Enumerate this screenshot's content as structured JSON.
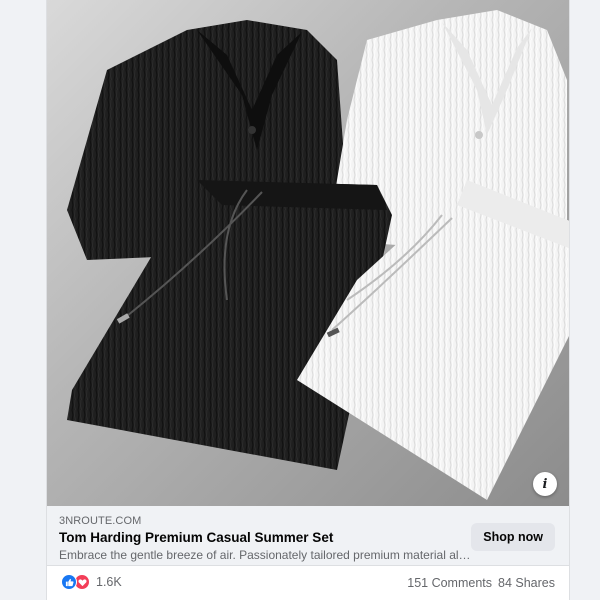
{
  "ad": {
    "image_alt": "",
    "domain": "3NROUTE.COM",
    "title": "Tom Harding Premium Casual Summer Set",
    "description": "Embrace the gentle breeze of air. Passionately tailored premium material allo...",
    "cta_label": "Shop now",
    "info_label": "i"
  },
  "engagement": {
    "reactions": [
      "like-icon",
      "love-icon"
    ],
    "reaction_count": "1.6K",
    "comments": "151 Comments",
    "shares": "84 Shares"
  },
  "colors": {
    "like": "#1877f2",
    "love": "#f33e58",
    "page_bg": "#f0f2f5",
    "link_bar_bg": "#f0f2f5",
    "cta_bg": "#e4e6eb"
  }
}
